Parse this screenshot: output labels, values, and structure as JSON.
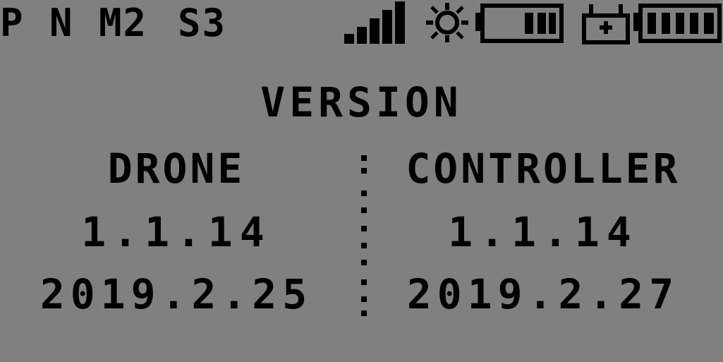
{
  "status": {
    "mode_p": "P",
    "mode_n": "N",
    "mode_m": "M2",
    "mode_s": "S3",
    "icons": [
      "signal-icon",
      "sun-icon",
      "drone-battery-icon",
      "controller-icon",
      "controller-battery-icon"
    ]
  },
  "title": "VERSION",
  "drone": {
    "label": "DRONE",
    "version": "1.1.14",
    "date": "2019.2.25"
  },
  "controller": {
    "label": "CONTROLLER",
    "version": "1.1.14",
    "date": "2019.2.27"
  },
  "separator": ":"
}
